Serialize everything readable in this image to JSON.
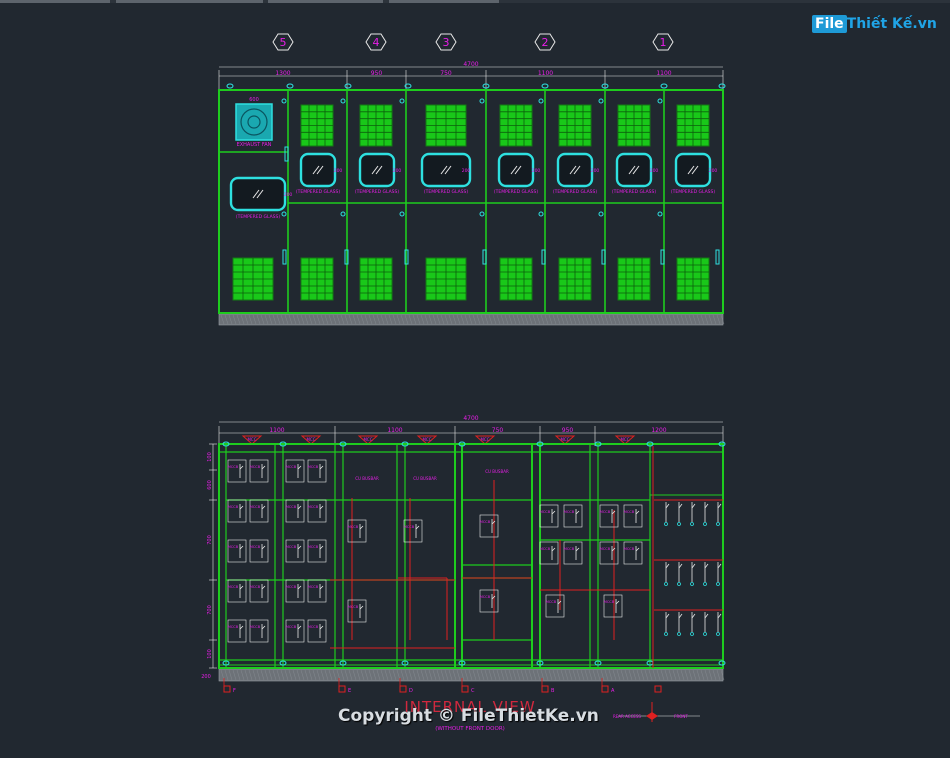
{
  "colors": {
    "background": "#212830",
    "panel": "#1ecc1e",
    "magenta": "#e81ee8",
    "cyan": "#2ee0e0",
    "red": "#e02020",
    "white": "#e8e8e8"
  },
  "logo": {
    "box": "File",
    "rest": "Thiết Kế.vn"
  },
  "watermark": {
    "copyright": "Copyright © FileThietKe.vn"
  },
  "front_view": {
    "overall_dim": "4700",
    "section_dims": [
      "1300",
      "950",
      "750",
      "1100",
      "1100"
    ],
    "markers": [
      "5",
      "4",
      "3",
      "2",
      "1"
    ],
    "fan_dim": "600",
    "fan_label": "EXHAUST FAN",
    "glass_dim": "200",
    "glass_label": "(TEMPERED GLASS)"
  },
  "internal_view": {
    "overall_dim": "4700",
    "section_dims": [
      "1100",
      "1100",
      "750",
      "950",
      "1200"
    ],
    "height_dims": [
      "100",
      "600",
      "700",
      "700",
      "100"
    ],
    "bottom_dim": "200",
    "title": "INTERNAL VIEW",
    "subtitle": "(WITHOUT FRONT DOOR)",
    "tag": "MCC",
    "breaker_label": "MCCB",
    "busbar_label": "CU BUSBAR",
    "section_markers": [
      "F",
      "E",
      "D",
      "C",
      "B",
      "A"
    ],
    "bottom_note": "REAR ACCESS",
    "side_note": "FRONT"
  }
}
